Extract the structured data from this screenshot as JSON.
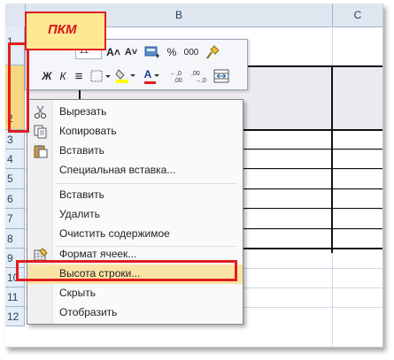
{
  "annotation": {
    "callout_text": "ПКМ",
    "color": "#e01e1e"
  },
  "columns": [
    "B",
    "C"
  ],
  "rows": [
    "1",
    "2",
    "3",
    "4",
    "5",
    "6",
    "7",
    "8",
    "9",
    "10",
    "11",
    "12"
  ],
  "toolbar": {
    "font_size_value": "11",
    "grow_font_icon": "A˄",
    "shrink_font_icon": "A˅",
    "percent": "%",
    "thousands": "000",
    "bold": "Ж",
    "italic": "К",
    "align_center": "≡",
    "font_color_glyph": "A",
    "decimal_inc": "←,0 .00",
    "decimal_dec": ",00 →,0"
  },
  "context_menu": {
    "items": [
      {
        "label": "Вырезать",
        "icon": "scissors-icon"
      },
      {
        "label": "Копировать",
        "icon": "copy-icon"
      },
      {
        "label": "Вставить",
        "icon": "paste-icon"
      },
      {
        "label": "Специальная вставка...",
        "icon": ""
      },
      {
        "label": "Вставить",
        "icon": ""
      },
      {
        "label": "Удалить",
        "icon": ""
      },
      {
        "label": "Очистить содержимое",
        "icon": ""
      },
      {
        "label": "Формат ячеек...",
        "icon": "format-cells-icon"
      },
      {
        "label": "Высота строки...",
        "icon": "",
        "highlighted": true
      },
      {
        "label": "Скрыть",
        "icon": ""
      },
      {
        "label": "Отобразить",
        "icon": ""
      }
    ]
  },
  "colors": {
    "highlight": "#fbe3a6",
    "header_bg": "#dfe6f0",
    "menu_border": "#868686"
  }
}
